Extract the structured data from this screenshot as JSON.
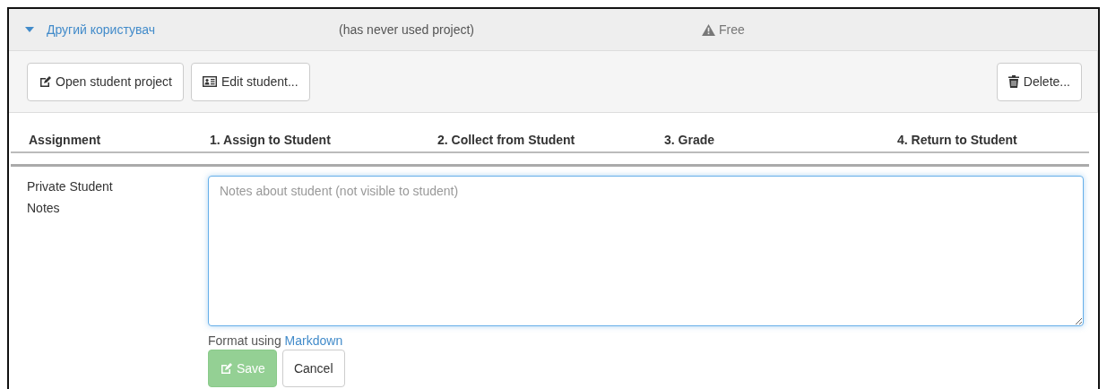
{
  "student": {
    "name": "Другий користувач",
    "expanded": true,
    "last_used": "(has never used project)",
    "status": "Free"
  },
  "toolbar": {
    "left_buttons": [
      {
        "label": "Open student project",
        "kind": "open"
      },
      {
        "label": "Edit student...",
        "kind": "edit"
      }
    ],
    "right_buttons": [
      {
        "label": "Delete...",
        "kind": "delete"
      }
    ]
  },
  "table": {
    "columns": [
      "Assignment",
      "1. Assign to Student",
      "2. Collect from Student",
      "3. Grade",
      "4. Return to Student"
    ]
  },
  "notes": {
    "label": "Private Student Notes",
    "placeholder": "Notes about student (not visible to student)",
    "hint": "Format using",
    "hint_link": "Markdown",
    "buttons": [
      {
        "label": "Save",
        "kind": "primary",
        "disabled": true
      },
      {
        "label": "Cancel",
        "kind": "default",
        "disabled": false
      }
    ]
  }
}
